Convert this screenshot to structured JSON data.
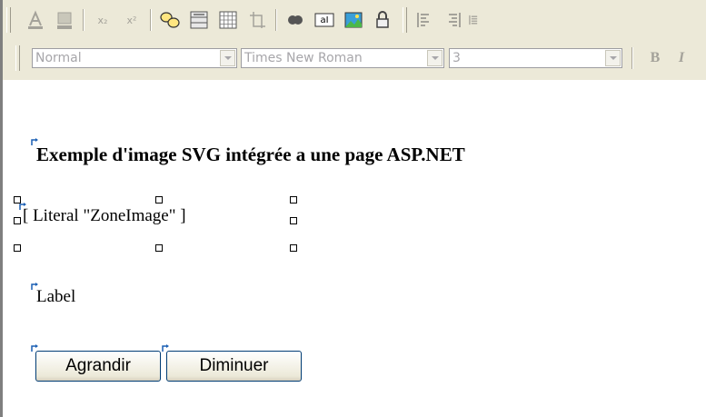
{
  "toolbar": {
    "row1_icons": [
      "font-color-icon",
      "highlight-color-icon",
      "subscript-icon",
      "superscript-icon",
      "properties-icon",
      "insert-table-icon",
      "table-grid-icon",
      "absolute-position-icon",
      "insert-bookmark-icon",
      "insert-form-field-icon",
      "insert-image-icon",
      "lock-icon",
      "align-left-icon",
      "align-right-icon"
    ],
    "subscript_text": "x₂",
    "superscript_text": "x²",
    "form_field_text": "aI",
    "block_format": "Normal",
    "font_name": "Times New Roman",
    "font_size": "3",
    "bold_label": "B",
    "italic_label": "I"
  },
  "editor": {
    "heading": "Exemple d'image SVG intégrée a une page ASP.NET",
    "literal_control": "[ Literal \"ZoneImage\" ]",
    "label_control": "Label",
    "buttons": {
      "enlarge": "Agrandir",
      "shrink": "Diminuer"
    }
  }
}
